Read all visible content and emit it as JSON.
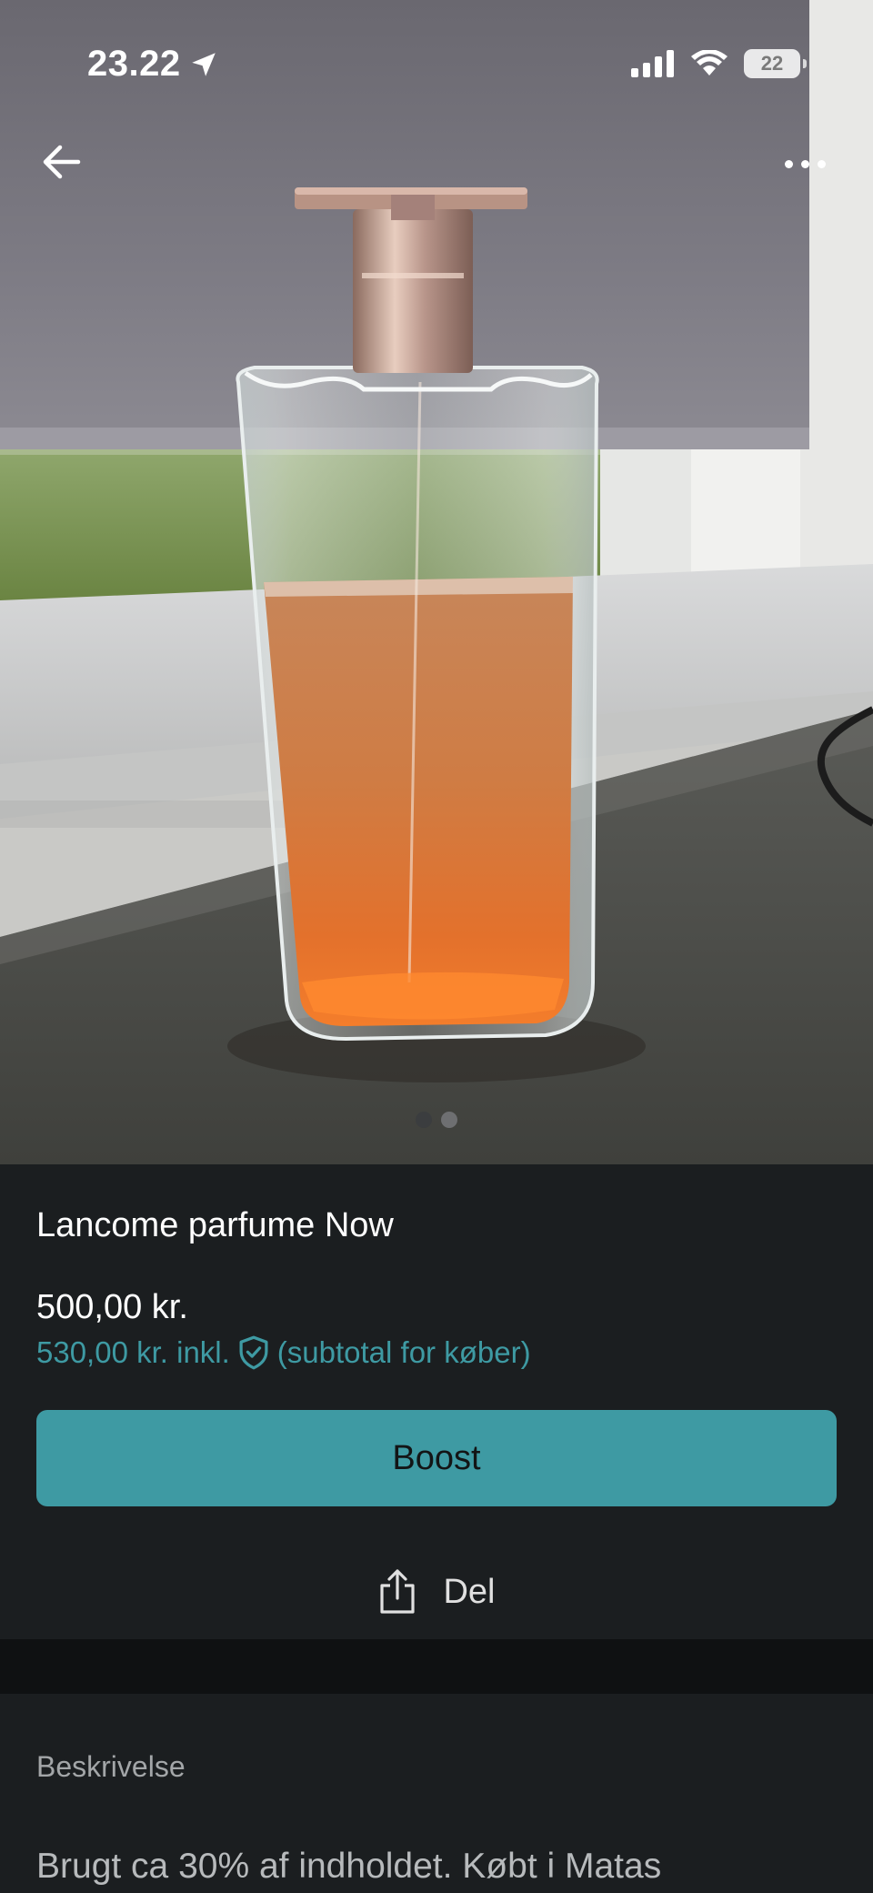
{
  "status_bar": {
    "time": "23.22",
    "battery": "22"
  },
  "listing": {
    "title": "Lancome parfume Now",
    "price": "500,00 kr.",
    "price_incl_amount": "530,00 kr. inkl.",
    "price_incl_note": "(subtotal for køber)",
    "gallery": {
      "current_index": 1,
      "total": 2
    }
  },
  "actions": {
    "boost_label": "Boost",
    "share_label": "Del"
  },
  "description": {
    "label": "Beskrivelse",
    "text": "Brugt ca 30% af indholdet. Købt i Matas"
  },
  "icons": {
    "back": "arrow-left-icon",
    "more": "more-horizontal-icon",
    "location": "location-arrow-icon",
    "signal": "signal-icon",
    "wifi": "wifi-icon",
    "battery": "battery-icon",
    "buyer_protection": "shield-check-icon",
    "share": "share-icon"
  },
  "colors": {
    "accent": "#3e9aa3",
    "background": "#1b1e20",
    "separator": "#0f1112"
  }
}
